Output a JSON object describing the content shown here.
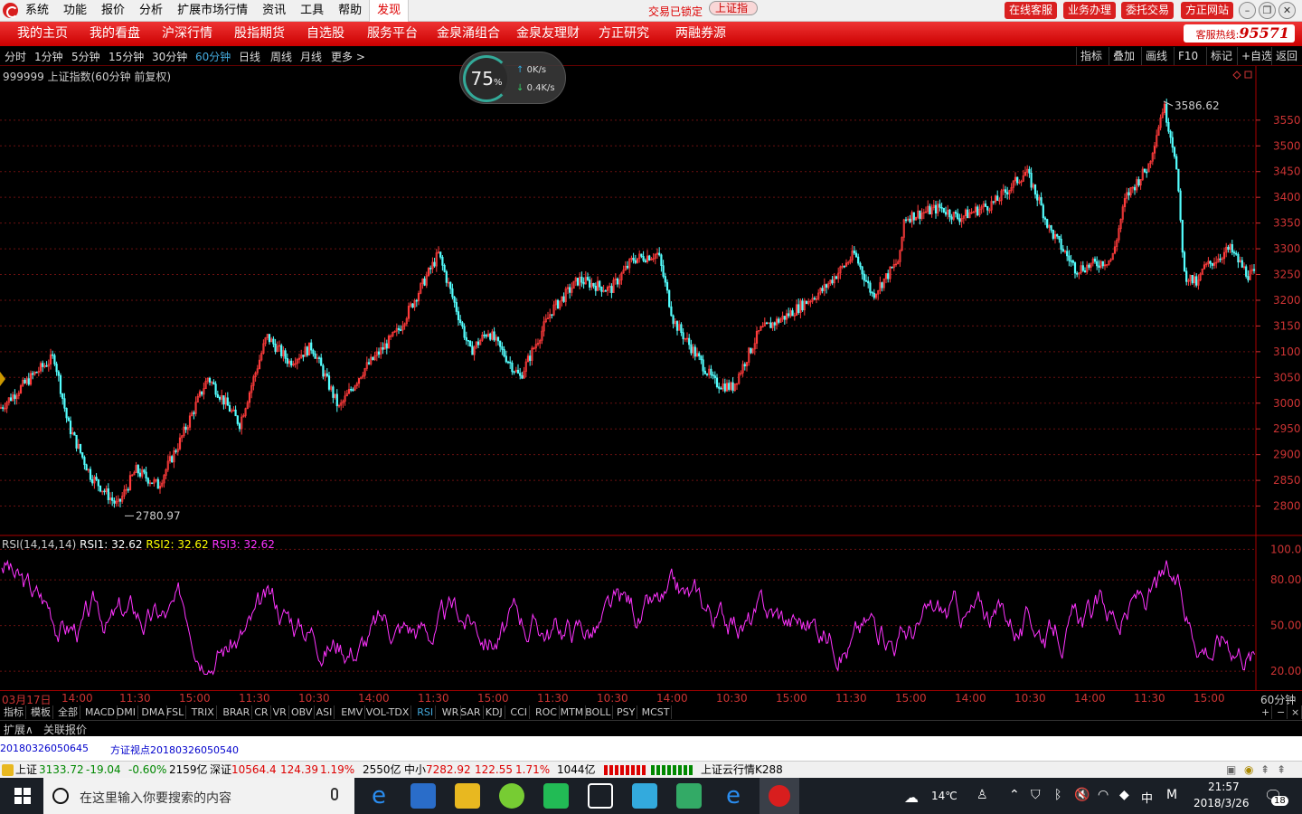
{
  "menu": {
    "items": [
      "系统",
      "功能",
      "报价",
      "分析",
      "扩展市场行情",
      "资讯",
      "工具",
      "帮助"
    ],
    "active": "发现",
    "lock_status": "交易已锁定",
    "index_pill": "上证指数"
  },
  "top_buttons": [
    "在线客服",
    "业务办理",
    "委托交易",
    "方正网站"
  ],
  "nav": {
    "items": [
      "我的主页",
      "我的看盘",
      "沪深行情",
      "股指期货",
      "自选股",
      "服务平台",
      "金泉涌组合",
      "金泉友理财",
      "方正研究",
      "两融券源"
    ],
    "hotline_label": "客服热线:",
    "hotline_number": "95571"
  },
  "periods": [
    "分时",
    "1分钟",
    "5分钟",
    "15分钟",
    "30分钟",
    "60分钟",
    "日线",
    "周线",
    "月线",
    "更多 >"
  ],
  "selected_period": "60分钟",
  "tools": [
    "指标",
    "叠加",
    "画线",
    "F10",
    "标记",
    "+自选",
    "返回"
  ],
  "speed": {
    "percent": "75",
    "percent_unit": "%",
    "up": "0K/s",
    "down": "0.4K/s"
  },
  "chart": {
    "title": "999999 上证指数(60分钟 前复权)",
    "high_label": "3586.62",
    "low_label": "2780.97",
    "price_ticks": [
      "3550",
      "3500",
      "3450",
      "3400",
      "3350",
      "3300",
      "3250",
      "3200",
      "3150",
      "3100",
      "3050",
      "3000",
      "2950",
      "2900",
      "2850",
      "2800"
    ],
    "ylim": [
      2750,
      3620
    ],
    "up_color": "#ff3b3b",
    "down_color": "#54ffff"
  },
  "rsi": {
    "label": "RSI(14,14,14)",
    "rsi1_label": "RSI1:",
    "rsi1_value": "32.62",
    "rsi2_label": "RSI2:",
    "rsi2_value": "32.62",
    "rsi3_label": "RSI3:",
    "rsi3_value": "32.62",
    "ticks": [
      "100.00",
      "80.00",
      "50.00",
      "20.00"
    ],
    "ylim": [
      10,
      105
    ],
    "line_color": "#ff33ff"
  },
  "time_axis": [
    "03月17日",
    "14:00",
    "11:30",
    "15:00",
    "11:30",
    "10:30",
    "14:00",
    "11:30",
    "15:00",
    "11:30",
    "10:30",
    "14:00",
    "10:30",
    "15:00",
    "11:30",
    "15:00",
    "14:00",
    "10:30",
    "14:00",
    "11:30",
    "15:00"
  ],
  "time_axis_period": "60分钟",
  "indicator_tabs": [
    "指标",
    "模板",
    "全部",
    "MACD",
    "DMI",
    "DMA",
    "FSL",
    "TRIX",
    "BRAR",
    "CR",
    "VR",
    "OBV",
    "ASI",
    "EMV",
    "VOL-TDX",
    "RSI",
    "WR",
    "SAR",
    "KDJ",
    "CCI",
    "ROC",
    "MTM",
    "BOLL",
    "PSY",
    "MCST"
  ],
  "selected_indicator": "RSI",
  "bottom_tabs": [
    "扩展∧",
    "关联报价"
  ],
  "news": [
    "20180326050645",
    "方证视点20180326050540"
  ],
  "status": {
    "sh_label": "上证",
    "sh_value": "3133.72",
    "sh_change": "-19.04",
    "sh_pct": "-0.60%",
    "sh_amount": "2159亿",
    "sz_label": "深证",
    "sz_value": "10564.4",
    "sz_change": "124.39",
    "sz_pct": "1.19%",
    "sz_amount": "2550亿",
    "zx_label": "中小",
    "zx_value": "7282.92",
    "zx_change": "122.55",
    "zx_pct": "1.71%",
    "zx_amount": "1044亿",
    "cloud": "上证云行情K288"
  },
  "taskbar": {
    "search_placeholder": "在这里输入你要搜索的内容",
    "weather": "14℃",
    "ime": "中",
    "time": "21:57",
    "date": "2018/3/26",
    "notifications": "18"
  }
}
